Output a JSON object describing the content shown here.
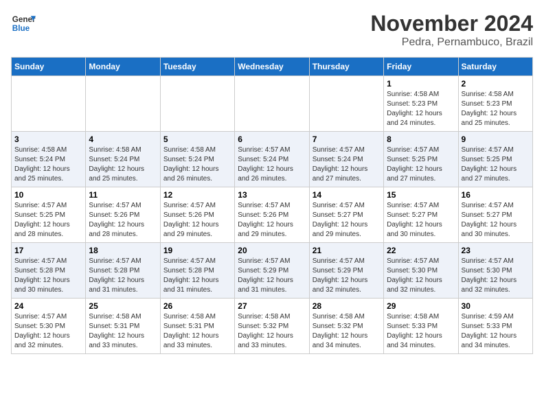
{
  "logo": {
    "line1": "General",
    "line2": "Blue"
  },
  "title": "November 2024",
  "location": "Pedra, Pernambuco, Brazil",
  "weekdays": [
    "Sunday",
    "Monday",
    "Tuesday",
    "Wednesday",
    "Thursday",
    "Friday",
    "Saturday"
  ],
  "weeks": [
    [
      {
        "day": "",
        "info": ""
      },
      {
        "day": "",
        "info": ""
      },
      {
        "day": "",
        "info": ""
      },
      {
        "day": "",
        "info": ""
      },
      {
        "day": "",
        "info": ""
      },
      {
        "day": "1",
        "info": "Sunrise: 4:58 AM\nSunset: 5:23 PM\nDaylight: 12 hours and 24 minutes."
      },
      {
        "day": "2",
        "info": "Sunrise: 4:58 AM\nSunset: 5:23 PM\nDaylight: 12 hours and 25 minutes."
      }
    ],
    [
      {
        "day": "3",
        "info": "Sunrise: 4:58 AM\nSunset: 5:24 PM\nDaylight: 12 hours and 25 minutes."
      },
      {
        "day": "4",
        "info": "Sunrise: 4:58 AM\nSunset: 5:24 PM\nDaylight: 12 hours and 25 minutes."
      },
      {
        "day": "5",
        "info": "Sunrise: 4:58 AM\nSunset: 5:24 PM\nDaylight: 12 hours and 26 minutes."
      },
      {
        "day": "6",
        "info": "Sunrise: 4:57 AM\nSunset: 5:24 PM\nDaylight: 12 hours and 26 minutes."
      },
      {
        "day": "7",
        "info": "Sunrise: 4:57 AM\nSunset: 5:24 PM\nDaylight: 12 hours and 27 minutes."
      },
      {
        "day": "8",
        "info": "Sunrise: 4:57 AM\nSunset: 5:25 PM\nDaylight: 12 hours and 27 minutes."
      },
      {
        "day": "9",
        "info": "Sunrise: 4:57 AM\nSunset: 5:25 PM\nDaylight: 12 hours and 27 minutes."
      }
    ],
    [
      {
        "day": "10",
        "info": "Sunrise: 4:57 AM\nSunset: 5:25 PM\nDaylight: 12 hours and 28 minutes."
      },
      {
        "day": "11",
        "info": "Sunrise: 4:57 AM\nSunset: 5:26 PM\nDaylight: 12 hours and 28 minutes."
      },
      {
        "day": "12",
        "info": "Sunrise: 4:57 AM\nSunset: 5:26 PM\nDaylight: 12 hours and 29 minutes."
      },
      {
        "day": "13",
        "info": "Sunrise: 4:57 AM\nSunset: 5:26 PM\nDaylight: 12 hours and 29 minutes."
      },
      {
        "day": "14",
        "info": "Sunrise: 4:57 AM\nSunset: 5:27 PM\nDaylight: 12 hours and 29 minutes."
      },
      {
        "day": "15",
        "info": "Sunrise: 4:57 AM\nSunset: 5:27 PM\nDaylight: 12 hours and 30 minutes."
      },
      {
        "day": "16",
        "info": "Sunrise: 4:57 AM\nSunset: 5:27 PM\nDaylight: 12 hours and 30 minutes."
      }
    ],
    [
      {
        "day": "17",
        "info": "Sunrise: 4:57 AM\nSunset: 5:28 PM\nDaylight: 12 hours and 30 minutes."
      },
      {
        "day": "18",
        "info": "Sunrise: 4:57 AM\nSunset: 5:28 PM\nDaylight: 12 hours and 31 minutes."
      },
      {
        "day": "19",
        "info": "Sunrise: 4:57 AM\nSunset: 5:28 PM\nDaylight: 12 hours and 31 minutes."
      },
      {
        "day": "20",
        "info": "Sunrise: 4:57 AM\nSunset: 5:29 PM\nDaylight: 12 hours and 31 minutes."
      },
      {
        "day": "21",
        "info": "Sunrise: 4:57 AM\nSunset: 5:29 PM\nDaylight: 12 hours and 32 minutes."
      },
      {
        "day": "22",
        "info": "Sunrise: 4:57 AM\nSunset: 5:30 PM\nDaylight: 12 hours and 32 minutes."
      },
      {
        "day": "23",
        "info": "Sunrise: 4:57 AM\nSunset: 5:30 PM\nDaylight: 12 hours and 32 minutes."
      }
    ],
    [
      {
        "day": "24",
        "info": "Sunrise: 4:57 AM\nSunset: 5:30 PM\nDaylight: 12 hours and 32 minutes."
      },
      {
        "day": "25",
        "info": "Sunrise: 4:58 AM\nSunset: 5:31 PM\nDaylight: 12 hours and 33 minutes."
      },
      {
        "day": "26",
        "info": "Sunrise: 4:58 AM\nSunset: 5:31 PM\nDaylight: 12 hours and 33 minutes."
      },
      {
        "day": "27",
        "info": "Sunrise: 4:58 AM\nSunset: 5:32 PM\nDaylight: 12 hours and 33 minutes."
      },
      {
        "day": "28",
        "info": "Sunrise: 4:58 AM\nSunset: 5:32 PM\nDaylight: 12 hours and 34 minutes."
      },
      {
        "day": "29",
        "info": "Sunrise: 4:58 AM\nSunset: 5:33 PM\nDaylight: 12 hours and 34 minutes."
      },
      {
        "day": "30",
        "info": "Sunrise: 4:59 AM\nSunset: 5:33 PM\nDaylight: 12 hours and 34 minutes."
      }
    ]
  ]
}
